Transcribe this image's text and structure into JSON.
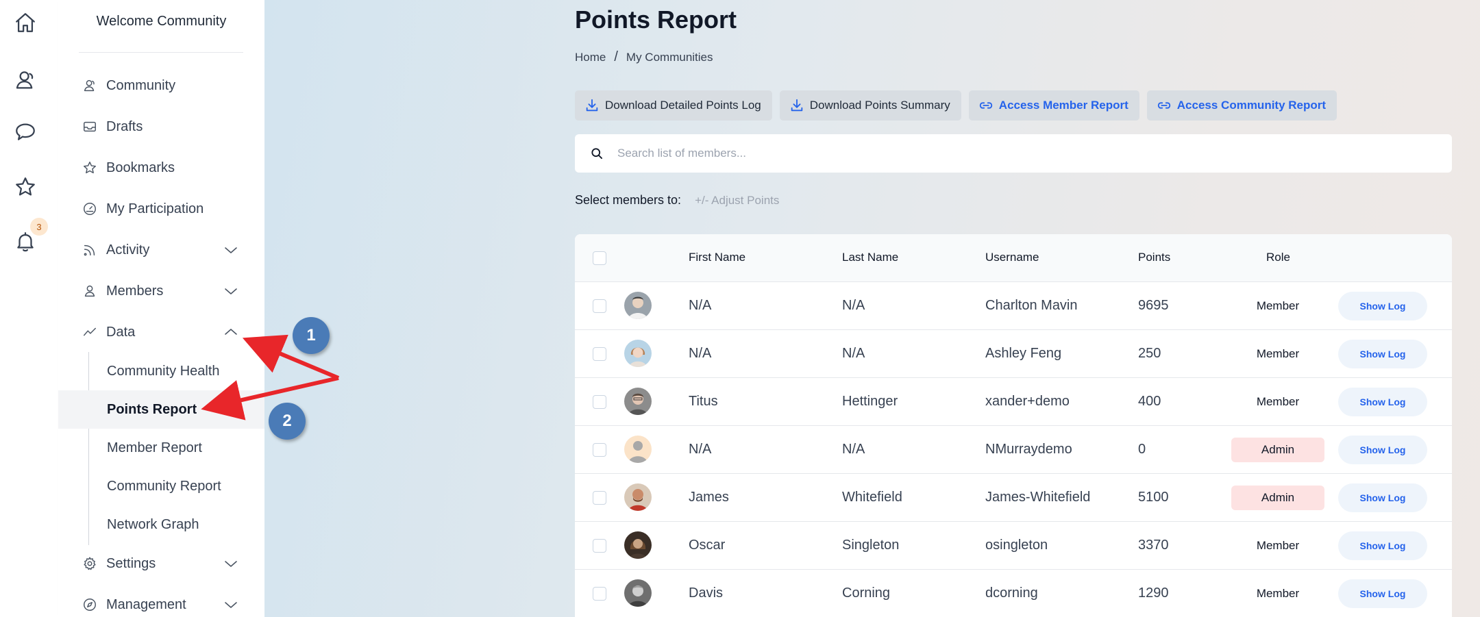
{
  "rail": {
    "icons": [
      "home-icon",
      "user-icon",
      "chat-icon",
      "star-icon",
      "bell-icon"
    ],
    "notification_count": "3"
  },
  "sidebar": {
    "title": "Welcome Community",
    "items": [
      {
        "label": "Community",
        "icon": "community-icon"
      },
      {
        "label": "Drafts",
        "icon": "inbox-icon"
      },
      {
        "label": "Bookmarks",
        "icon": "star-icon"
      },
      {
        "label": "My Participation",
        "icon": "gauge-icon"
      },
      {
        "label": "Activity",
        "icon": "rss-icon"
      },
      {
        "label": "Members",
        "icon": "user-icon"
      },
      {
        "label": "Data",
        "icon": "trend-icon"
      },
      {
        "label": "Settings",
        "icon": "gear-icon"
      },
      {
        "label": "Management",
        "icon": "compass-icon"
      }
    ],
    "data_subitems": [
      "Community Health",
      "Points Report",
      "Member Report",
      "Community Report",
      "Network Graph"
    ],
    "active_subitem": "Points Report"
  },
  "page": {
    "title": "Points Report",
    "breadcrumb": [
      "Home",
      "/",
      "My Communities"
    ]
  },
  "toolbar": {
    "download_log": "Download Detailed Points Log",
    "download_summary": "Download Points Summary",
    "member_report": "Access Member Report",
    "community_report": "Access Community Report"
  },
  "search": {
    "placeholder": "Search list of members...",
    "value": ""
  },
  "select_row": {
    "label": "Select members to:",
    "adjust": "+/- Adjust Points"
  },
  "table": {
    "columns": [
      "First Name",
      "Last Name",
      "Username",
      "Points",
      "Role"
    ],
    "show_log_label": "Show Log",
    "rows": [
      {
        "first": "N/A",
        "last": "N/A",
        "username": "Charlton Mavin",
        "points": "9695",
        "role": "Member"
      },
      {
        "first": "N/A",
        "last": "N/A",
        "username": "Ashley Feng",
        "points": "250",
        "role": "Member"
      },
      {
        "first": "Titus",
        "last": "Hettinger",
        "username": "xander+demo",
        "points": "400",
        "role": "Member"
      },
      {
        "first": "N/A",
        "last": "N/A",
        "username": "NMurraydemo",
        "points": "0",
        "role": "Admin"
      },
      {
        "first": "James",
        "last": "Whitefield",
        "username": "James-Whitefield",
        "points": "5100",
        "role": "Admin"
      },
      {
        "first": "Oscar",
        "last": "Singleton",
        "username": "osingleton",
        "points": "3370",
        "role": "Member"
      },
      {
        "first": "Davis",
        "last": "Corning",
        "username": "dcorning",
        "points": "1290",
        "role": "Member"
      }
    ]
  },
  "annotations": {
    "callout_1": "1",
    "callout_2": "2",
    "arrow_color": "#e8262a",
    "callout_color": "#4a7bb7"
  }
}
